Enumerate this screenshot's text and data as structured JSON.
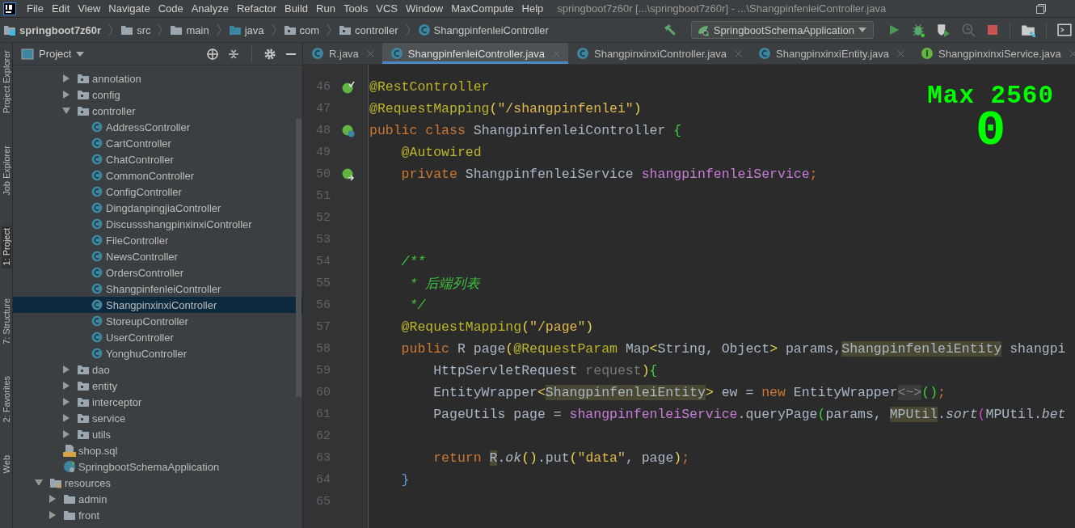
{
  "title_bar": {
    "menus": [
      "File",
      "Edit",
      "View",
      "Navigate",
      "Code",
      "Analyze",
      "Refactor",
      "Build",
      "Run",
      "Tools",
      "VCS",
      "Window",
      "MaxCompute",
      "Help"
    ],
    "title": "springboot7z60r [...\\springboot7z60r] - ...\\ShangpinfenleiController.java"
  },
  "breadcrumbs": [
    {
      "label": "springboot7z60r",
      "kind": "project"
    },
    {
      "label": "src",
      "kind": "folder"
    },
    {
      "label": "main",
      "kind": "folder"
    },
    {
      "label": "java",
      "kind": "source"
    },
    {
      "label": "com",
      "kind": "package"
    },
    {
      "label": "controller",
      "kind": "package"
    },
    {
      "label": "ShangpinfenleiController",
      "kind": "class"
    }
  ],
  "run_config": {
    "label": "SpringbootSchemaApplication"
  },
  "side_tabs": [
    {
      "label": "Project Explorer",
      "selected": false
    },
    {
      "label": "Job Explorer",
      "selected": false
    },
    {
      "label": "1: Project",
      "selected": true
    },
    {
      "label": "7: Structure",
      "selected": false
    },
    {
      "label": "2: Favorites",
      "selected": false
    },
    {
      "label": "Web",
      "selected": false
    }
  ],
  "project_panel": {
    "title": "Project",
    "tree": [
      {
        "children": [
          {
            "children": [
              {
                "label": "annotation",
                "kind": "package",
                "expanded": false,
                "selected": false
              },
              {
                "label": "config",
                "kind": "package",
                "expanded": false,
                "selected": false
              },
              {
                "label": "controller",
                "kind": "package",
                "expanded": true,
                "selected": false,
                "children": [
                  {
                    "label": "AddressController",
                    "kind": "class",
                    "selected": false
                  },
                  {
                    "label": "CartController",
                    "kind": "class",
                    "selected": false
                  },
                  {
                    "label": "ChatController",
                    "kind": "class",
                    "selected": false
                  },
                  {
                    "label": "CommonController",
                    "kind": "class",
                    "selected": false
                  },
                  {
                    "label": "ConfigController",
                    "kind": "class",
                    "selected": false
                  },
                  {
                    "label": "DingdanpingjiaController",
                    "kind": "class",
                    "selected": false
                  },
                  {
                    "label": "DiscussshangpinxinxiController",
                    "kind": "class",
                    "selected": false
                  },
                  {
                    "label": "FileController",
                    "kind": "class",
                    "selected": false
                  },
                  {
                    "label": "NewsController",
                    "kind": "class",
                    "selected": false
                  },
                  {
                    "label": "OrdersController",
                    "kind": "class",
                    "selected": false
                  },
                  {
                    "label": "ShangpinfenleiController",
                    "kind": "class",
                    "selected": false
                  },
                  {
                    "label": "ShangpinxinxiController",
                    "kind": "class",
                    "selected": true
                  },
                  {
                    "label": "StoreupController",
                    "kind": "class",
                    "selected": false
                  },
                  {
                    "label": "UserController",
                    "kind": "class",
                    "selected": false
                  },
                  {
                    "label": "YonghuController",
                    "kind": "class",
                    "selected": false
                  }
                ]
              },
              {
                "label": "dao",
                "kind": "package",
                "expanded": false,
                "selected": false
              },
              {
                "label": "entity",
                "kind": "package",
                "expanded": false,
                "selected": false
              },
              {
                "label": "interceptor",
                "kind": "package",
                "expanded": false,
                "selected": false
              },
              {
                "label": "service",
                "kind": "package",
                "expanded": false,
                "selected": false
              },
              {
                "label": "utils",
                "kind": "package",
                "expanded": false,
                "selected": false
              }
            ]
          },
          {
            "label": "shop.sql",
            "kind": "sql",
            "selected": false
          },
          {
            "label": "SpringbootSchemaApplication",
            "kind": "app",
            "selected": false
          }
        ]
      },
      {
        "label": "resources",
        "kind": "resources",
        "expanded": true,
        "selected": false,
        "children": [
          {
            "label": "admin",
            "kind": "folder",
            "expanded": false,
            "selected": false
          },
          {
            "label": "front",
            "kind": "folder",
            "expanded": false,
            "selected": false
          }
        ]
      }
    ]
  },
  "editor_tabs": [
    {
      "label": "R.java",
      "kind": "class",
      "selected": false
    },
    {
      "label": "ShangpinfenleiController.java",
      "kind": "class",
      "selected": true
    },
    {
      "label": "ShangpinxinxiController.java",
      "kind": "class",
      "selected": false
    },
    {
      "label": "ShangpinxinxiEntity.java",
      "kind": "class",
      "selected": false
    },
    {
      "label": "ShangpinxinxiService.java",
      "kind": "interface",
      "selected": false
    }
  ],
  "code_lines": [
    {
      "number": "46",
      "kind": "bean-check",
      "tokens": [
        {
          "text": "@RestController",
          "kind": "annotation"
        }
      ]
    },
    {
      "number": "47",
      "kind": "plain",
      "tokens": [
        {
          "text": "@RequestMapping",
          "kind": "annotation"
        },
        {
          "text": "(",
          "kind": "bracket-yellow"
        },
        {
          "text": "\"/shangpinfenlei\"",
          "kind": "string"
        },
        {
          "text": ")",
          "kind": "bracket-yellow"
        }
      ]
    },
    {
      "number": "48",
      "kind": "bean-class",
      "tokens": [
        {
          "text": "public class ",
          "kind": "keyword"
        },
        {
          "text": "ShangpinfenleiController ",
          "kind": "plain"
        },
        {
          "text": "{",
          "kind": "bracket-green"
        }
      ]
    },
    {
      "number": "49",
      "kind": "plain",
      "tokens": [
        {
          "text": "    @Autowired",
          "kind": "annotation"
        }
      ]
    },
    {
      "number": "50",
      "kind": "bean-link",
      "tokens": [
        {
          "text": "    private ",
          "kind": "keyword"
        },
        {
          "text": "ShangpinfenleiService ",
          "kind": "plain"
        },
        {
          "text": "shangpinfenleiService",
          "kind": "field"
        },
        {
          "text": ";",
          "kind": "keyword"
        }
      ]
    },
    {
      "number": "51",
      "kind": "plain"
    },
    {
      "number": "52",
      "kind": "plain"
    },
    {
      "number": "53",
      "kind": "plain"
    },
    {
      "number": "54",
      "kind": "plain",
      "tokens": [
        {
          "text": "    /**",
          "kind": "comment"
        }
      ]
    },
    {
      "number": "55",
      "kind": "plain",
      "tokens": [
        {
          "text": "     * 后端列表",
          "kind": "comment"
        }
      ]
    },
    {
      "number": "56",
      "kind": "plain",
      "tokens": [
        {
          "text": "     */",
          "kind": "comment"
        }
      ]
    },
    {
      "number": "57",
      "kind": "plain",
      "tokens": [
        {
          "text": "    @RequestMapping",
          "kind": "annotation"
        },
        {
          "text": "(",
          "kind": "bracket-yellow"
        },
        {
          "text": "\"/page\"",
          "kind": "string"
        },
        {
          "text": ")",
          "kind": "bracket-yellow"
        }
      ]
    },
    {
      "number": "58",
      "kind": "plain",
      "tokens": [
        {
          "text": "    public ",
          "kind": "keyword"
        },
        {
          "text": "R page",
          "kind": "plain"
        },
        {
          "text": "(",
          "kind": "bracket-yellow"
        },
        {
          "text": "@RequestParam ",
          "kind": "annotation"
        },
        {
          "text": "Map",
          "kind": "plain"
        },
        {
          "text": "<",
          "kind": "bracket-yellow"
        },
        {
          "text": "String, Object",
          "kind": "plain"
        },
        {
          "text": ">",
          "kind": "bracket-yellow"
        },
        {
          "text": " params,",
          "kind": "plain"
        },
        {
          "text": "ShangpinfenleiEntity",
          "kind": "highlight"
        },
        {
          "text": " shangpi",
          "kind": "plain"
        }
      ]
    },
    {
      "number": "59",
      "kind": "plain",
      "tokens": [
        {
          "text": "        HttpServletRequest ",
          "kind": "plain"
        },
        {
          "text": "request",
          "kind": "unused"
        },
        {
          "text": ")",
          "kind": "bracket-yellow"
        },
        {
          "text": "{",
          "kind": "bracket-green"
        }
      ]
    },
    {
      "number": "60",
      "kind": "plain",
      "tokens": [
        {
          "text": "        EntityWrapper",
          "kind": "plain"
        },
        {
          "text": "<",
          "kind": "bracket-yellow"
        },
        {
          "text": "ShangpinfenleiEntity",
          "kind": "highlight"
        },
        {
          "text": ">",
          "kind": "bracket-yellow"
        },
        {
          "text": " ew = ",
          "kind": "plain"
        },
        {
          "text": "new ",
          "kind": "keyword"
        },
        {
          "text": "EntityWrapper",
          "kind": "plain"
        },
        {
          "text": "<~>",
          "kind": "fold"
        },
        {
          "text": "()",
          "kind": "bracket-green"
        },
        {
          "text": ";",
          "kind": "keyword"
        }
      ]
    },
    {
      "number": "61",
      "kind": "plain",
      "tokens": [
        {
          "text": "        PageUtils page = ",
          "kind": "plain"
        },
        {
          "text": "shangpinfenleiService",
          "kind": "field"
        },
        {
          "text": ".queryPage",
          "kind": "plain"
        },
        {
          "text": "(",
          "kind": "bracket-green"
        },
        {
          "text": "params, ",
          "kind": "plain"
        },
        {
          "text": "MPUtil",
          "kind": "highlight"
        },
        {
          "text": ".",
          "kind": "plain"
        },
        {
          "text": "sort",
          "kind": "static"
        },
        {
          "text": "(",
          "kind": "bracket-purple"
        },
        {
          "text": "MPUtil.",
          "kind": "plain"
        },
        {
          "text": "bet",
          "kind": "static"
        }
      ]
    },
    {
      "number": "62",
      "kind": "plain"
    },
    {
      "number": "63",
      "kind": "plain",
      "tokens": [
        {
          "text": "        return ",
          "kind": "keyword"
        },
        {
          "text": "R",
          "kind": "highlight"
        },
        {
          "text": ".",
          "kind": "plain"
        },
        {
          "text": "ok",
          "kind": "static"
        },
        {
          "text": "()",
          "kind": "bracket-yellow"
        },
        {
          "text": ".put",
          "kind": "plain"
        },
        {
          "text": "(",
          "kind": "bracket-yellow"
        },
        {
          "text": "\"data\"",
          "kind": "string"
        },
        {
          "text": ", page",
          "kind": "plain"
        },
        {
          "text": ")",
          "kind": "bracket-yellow"
        },
        {
          "text": ";",
          "kind": "keyword"
        }
      ]
    },
    {
      "number": "64",
      "kind": "plain",
      "tokens": [
        {
          "text": "    }",
          "kind": "bracket-blue"
        }
      ]
    },
    {
      "number": "65",
      "kind": "plain"
    }
  ],
  "power_mode": {
    "label": "Max 2560",
    "count": "0"
  }
}
